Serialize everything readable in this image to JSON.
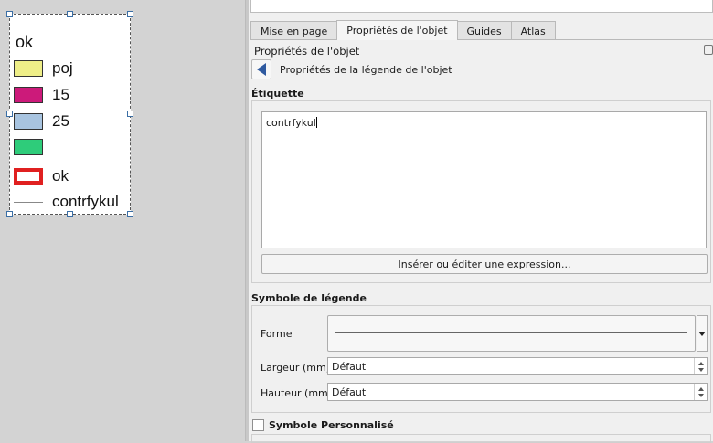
{
  "legend": {
    "title": "ok",
    "items": [
      {
        "label": "poj",
        "symbol": "fill",
        "color": "#eeee88"
      },
      {
        "label": "15",
        "symbol": "fill",
        "color": "#cc1a7a"
      },
      {
        "label": "25",
        "symbol": "fill",
        "color": "#a8c4e0"
      },
      {
        "label": "",
        "symbol": "fill",
        "color": "#2ecc7a"
      },
      {
        "label": "ok",
        "symbol": "outline",
        "color": "#e02020"
      },
      {
        "label": "contrfykul",
        "symbol": "line",
        "color": "#888888"
      }
    ]
  },
  "tabs": [
    {
      "label": "Mise en page",
      "active": false
    },
    {
      "label": "Propriétés de l'objet",
      "active": true
    },
    {
      "label": "Guides",
      "active": false
    },
    {
      "label": "Atlas",
      "active": false
    }
  ],
  "panel": {
    "title": "Propriétés de l'objet",
    "subtitle": "Propriétés de la légende de l'objet"
  },
  "etiquette": {
    "heading": "Étiquette",
    "text": "contrfykul",
    "expr_button": "Insérer ou éditer une expression..."
  },
  "symbole": {
    "heading": "Symbole de légende",
    "forme_label": "Forme",
    "largeur_label": "Largeur (mm)",
    "largeur_value": "Défaut",
    "hauteur_label": "Hauteur (mm)",
    "hauteur_value": "Défaut"
  },
  "custom": {
    "label": "Symbole Personnalisé",
    "checked": false
  }
}
